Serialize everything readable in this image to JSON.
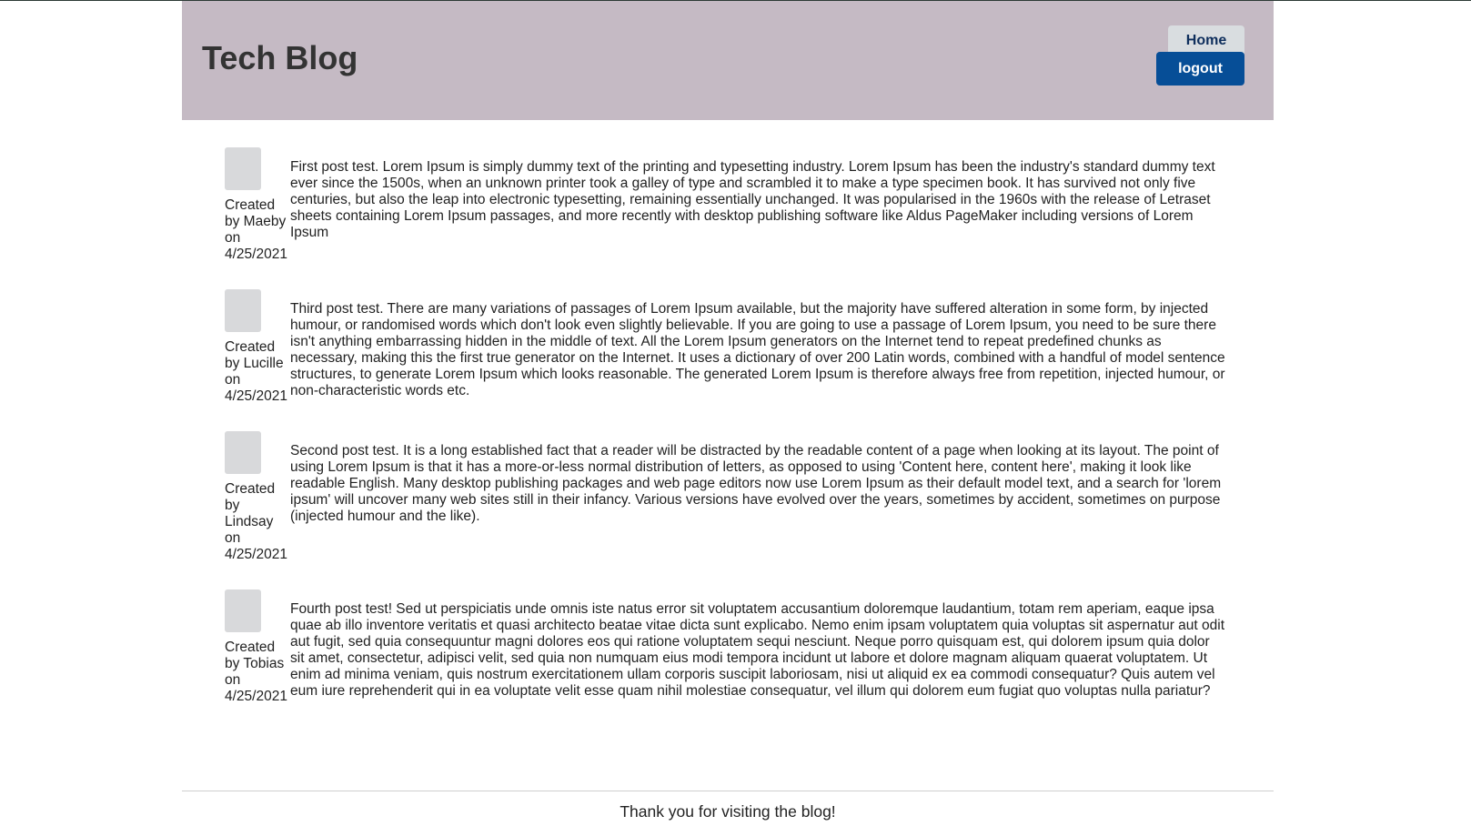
{
  "header": {
    "title": "Tech Blog",
    "nav": {
      "home_label": "Home",
      "logout_label": "logout"
    },
    "background_color": "#c5bac4",
    "logout_color": "#064e97"
  },
  "posts": [
    {
      "created_label": "Created by Maeby on 4/25/2021",
      "author": "Maeby",
      "date": "4/25/2021",
      "body": "First post test. Lorem Ipsum is simply dummy text of the printing and typesetting industry. Lorem Ipsum has been the industry's standard dummy text ever since the 1500s, when an unknown printer took a galley of type and scrambled it to make a type specimen book. It has survived not only five centuries, but also the leap into electronic typesetting, remaining essentially unchanged. It was popularised in the 1960s with the release of Letraset sheets containing Lorem Ipsum passages, and more recently with desktop publishing software like Aldus PageMaker including versions of Lorem Ipsum"
    },
    {
      "created_label": "Created by Lucille on 4/25/2021",
      "author": "Lucille",
      "date": "4/25/2021",
      "body": "Third post test. There are many variations of passages of Lorem Ipsum available, but the majority have suffered alteration in some form, by injected humour, or randomised words which don't look even slightly believable. If you are going to use a passage of Lorem Ipsum, you need to be sure there isn't anything embarrassing hidden in the middle of text. All the Lorem Ipsum generators on the Internet tend to repeat predefined chunks as necessary, making this the first true generator on the Internet. It uses a dictionary of over 200 Latin words, combined with a handful of model sentence structures, to generate Lorem Ipsum which looks reasonable. The generated Lorem Ipsum is therefore always free from repetition, injected humour, or non-characteristic words etc."
    },
    {
      "created_label": "Created by Lindsay on 4/25/2021",
      "author": "Lindsay",
      "date": "4/25/2021",
      "body": "Second post test. It is a long established fact that a reader will be distracted by the readable content of a page when looking at its layout. The point of using Lorem Ipsum is that it has a more-or-less normal distribution of letters, as opposed to using 'Content here, content here', making it look like readable English. Many desktop publishing packages and web page editors now use Lorem Ipsum as their default model text, and a search for 'lorem ipsum' will uncover many web sites still in their infancy. Various versions have evolved over the years, sometimes by accident, sometimes on purpose (injected humour and the like)."
    },
    {
      "created_label": "Created by Tobias on 4/25/2021",
      "author": "Tobias",
      "date": "4/25/2021",
      "body": "Fourth post test! Sed ut perspiciatis unde omnis iste natus error sit voluptatem accusantium doloremque laudantium, totam rem aperiam, eaque ipsa quae ab illo inventore veritatis et quasi architecto beatae vitae dicta sunt explicabo. Nemo enim ipsam voluptatem quia voluptas sit aspernatur aut odit aut fugit, sed quia consequuntur magni dolores eos qui ratione voluptatem sequi nesciunt. Neque porro quisquam est, qui dolorem ipsum quia dolor sit amet, consectetur, adipisci velit, sed quia non numquam eius modi tempora incidunt ut labore et dolore magnam aliquam quaerat voluptatem. Ut enim ad minima veniam, quis nostrum exercitationem ullam corporis suscipit laboriosam, nisi ut aliquid ex ea commodi consequatur? Quis autem vel eum iure reprehenderit qui in ea voluptate velit esse quam nihil molestiae consequatur, vel illum qui dolorem eum fugiat quo voluptas nulla pariatur?"
    }
  ],
  "footer": {
    "text": "Thank you for visiting the blog!"
  }
}
